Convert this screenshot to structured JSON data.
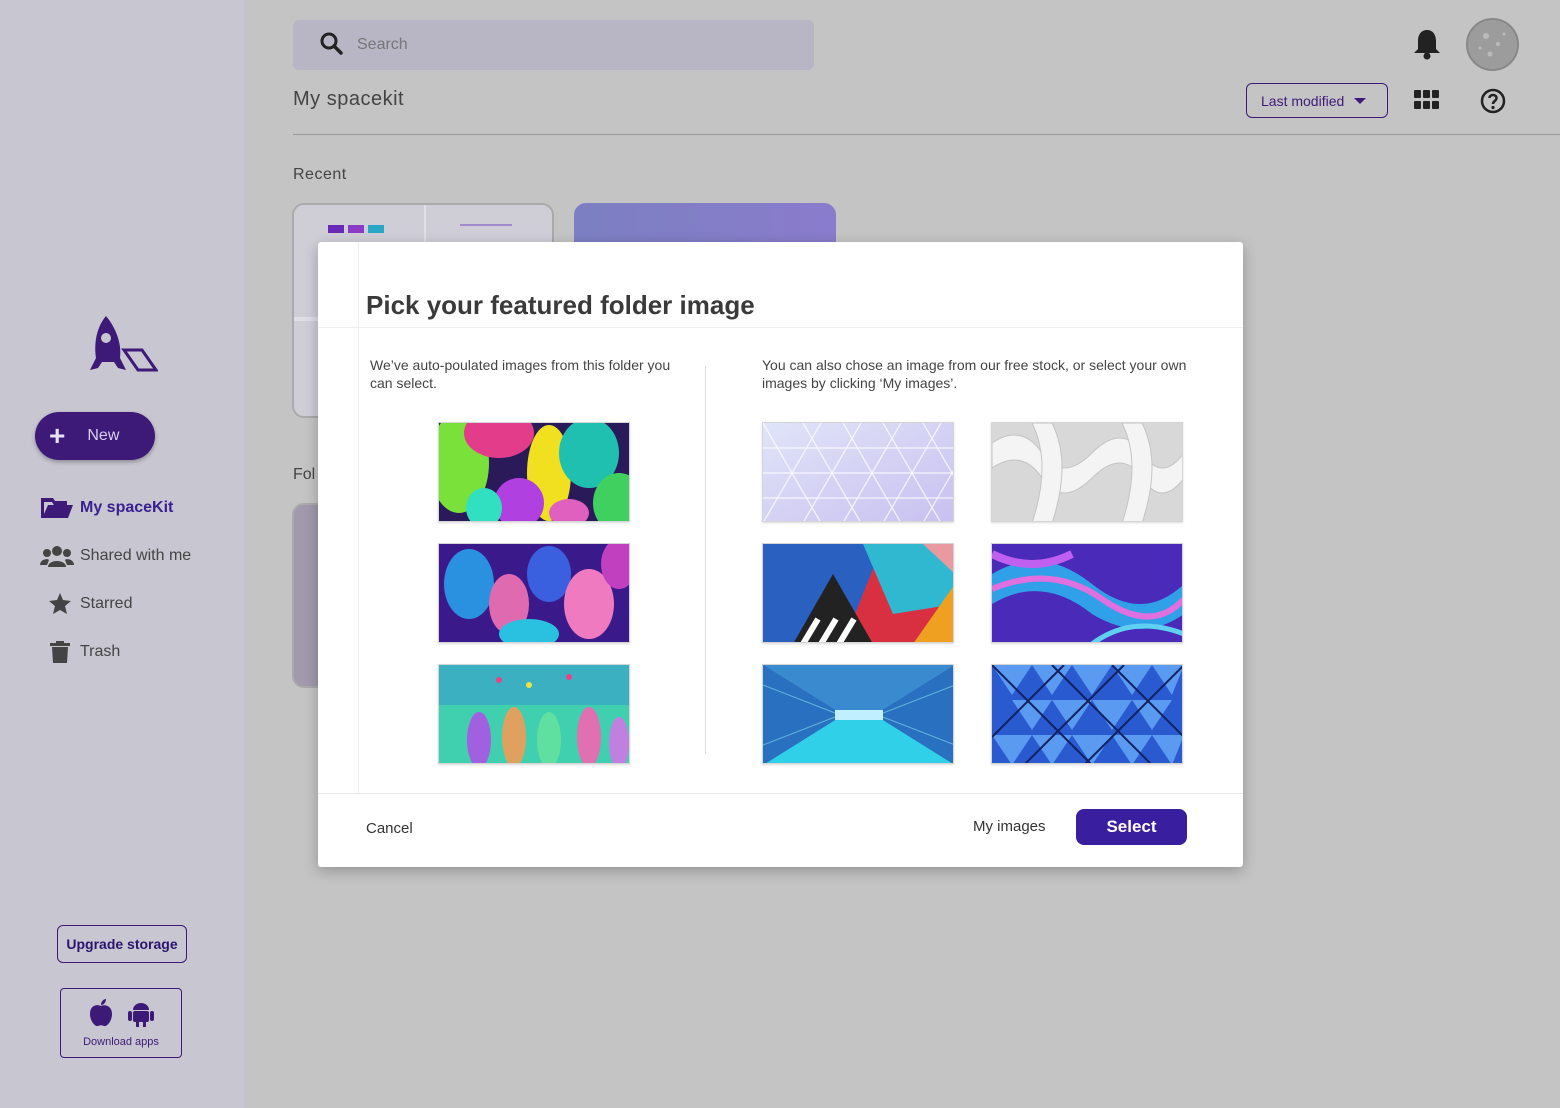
{
  "search": {
    "placeholder": "Search"
  },
  "header": {
    "title": "My spacekit",
    "sort_label": "Last modified"
  },
  "sections": {
    "recent": "Recent",
    "folders": "Fol"
  },
  "sidebar": {
    "new_label": "New",
    "items": [
      {
        "label": "My spaceKit",
        "icon": "folder-open-icon",
        "active": true
      },
      {
        "label": "Shared with me",
        "icon": "users-icon",
        "active": false
      },
      {
        "label": "Starred",
        "icon": "star-icon",
        "active": false
      },
      {
        "label": "Trash",
        "icon": "trash-icon",
        "active": false
      }
    ],
    "upgrade_label": "Upgrade storage",
    "download_label": "Download apps"
  },
  "modal": {
    "title": "Pick your featured folder image",
    "left_text": "We’ve auto-poulated images from this folder you can select.",
    "right_text": "You can also chose an image from our free stock, or select your own images by clicking ‘My images’.",
    "cancel_label": "Cancel",
    "my_images_label": "My images",
    "select_label": "Select",
    "left_images": [
      "jungle-neon-leaves",
      "purple-floral-leaves",
      "teal-underwater-plants"
    ],
    "right_images": [
      "lavender-triangle-pattern",
      "white-3d-weave",
      "red-cyan-abstract-mural",
      "purple-blue-fluid-art",
      "blue-tunnel-corridor",
      "blue-triangle-glass-roof"
    ]
  },
  "colors": {
    "accent": "#3a1ea0",
    "sidebar_bg": "#c8c6d0",
    "overlay_bg": "#c4c4c4"
  }
}
